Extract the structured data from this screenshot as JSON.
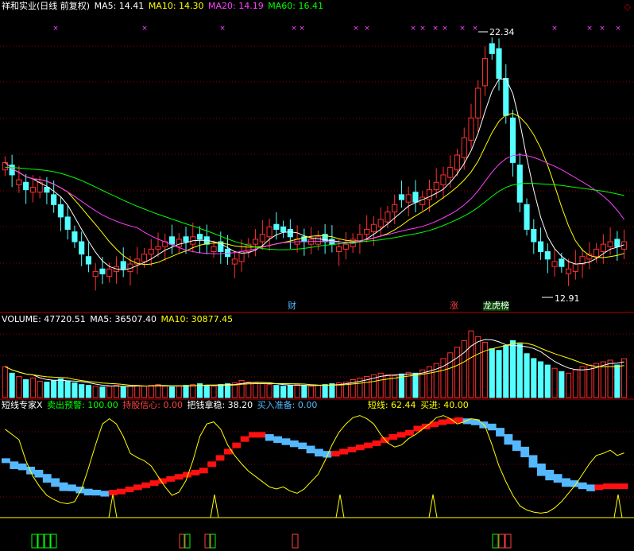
{
  "colors": {
    "up": "#ff3030",
    "down": "#54ffff",
    "ma5": "#ffffff",
    "ma10": "#ffff00",
    "ma20": "#ff40ff",
    "ma60": "#00ff00",
    "grid": "#8b0000",
    "axis": "#b00000",
    "sell": "#00ff00",
    "hold": "#ff4040",
    "grab": "#ffffff",
    "buy": "#54b8ff",
    "short": "#ffff00",
    "enter": "#ffff00"
  },
  "header": {
    "title": "祥和实业(日线 前复权)",
    "ma5": "MA5: 14.41",
    "ma10": "MA10: 14.30",
    "ma20": "MA20: 14.19",
    "ma60": "MA60: 16.41"
  },
  "corner_icon": "diamond-icon",
  "price_panel": {
    "high_label": "22.34",
    "low_label": "12.91",
    "events": [
      {
        "text": "财",
        "color": "#54b8ff"
      },
      {
        "text": "涨",
        "color": "#ff4040"
      },
      {
        "text": "龙虎榜",
        "color": "#ffffff"
      }
    ]
  },
  "volume_panel": {
    "volume": "VOLUME: 47720.51",
    "ma5": "MA5: 36507.40",
    "ma10": "MA10: 30877.45"
  },
  "indicator_panel": {
    "name": "短线专家X",
    "sell_warning": "卖出预警: 100.00",
    "hold_confidence": "持股信心: 0.00",
    "grab_money": "把钱拿稳: 38.20",
    "buy_ready": "买入准备: 0.00",
    "short_line": "短线: 62.44",
    "buy_in": "买进: 40.00"
  },
  "chart_data": [
    {
      "type": "candlestick",
      "title": "祥和实业(日线 前复权)",
      "ylim": [
        11.8,
        23.2
      ],
      "series": [
        {
          "name": "MA5",
          "value": 14.41
        },
        {
          "name": "MA10",
          "value": 14.3
        },
        {
          "name": "MA20",
          "value": 14.19
        },
        {
          "name": "MA60",
          "value": 16.41
        }
      ],
      "annotations": [
        {
          "text": "22.34",
          "kind": "high"
        },
        {
          "text": "12.91",
          "kind": "low"
        }
      ],
      "close": [
        17.6,
        17.1,
        16.9,
        16.5,
        16.6,
        16.8,
        16.4,
        15.9,
        15.4,
        14.9,
        14.4,
        13.9,
        13.5,
        13.2,
        13.1,
        13.3,
        13.4,
        13.3,
        13.5,
        13.7,
        13.9,
        14.1,
        14.2,
        14.4,
        14.3,
        14.5,
        14.4,
        14.6,
        14.5,
        14.3,
        14.2,
        14.0,
        13.8,
        13.7,
        14.0,
        14.3,
        14.5,
        14.7,
        15.0,
        14.9,
        14.8,
        14.6,
        14.5,
        14.4,
        14.5,
        14.6,
        14.4,
        14.3,
        14.2,
        14.3,
        14.5,
        14.7,
        14.9,
        15.1,
        15.3,
        15.6,
        15.9,
        16.1,
        16.3,
        16.0,
        16.2,
        16.5,
        16.8,
        17.1,
        17.4,
        17.9,
        18.6,
        19.4,
        20.6,
        21.8,
        22.0,
        21.0,
        19.5,
        17.6,
        16.0,
        14.9,
        14.4,
        14.0,
        13.7,
        13.6,
        13.4,
        13.3,
        13.5,
        13.8,
        13.9,
        14.1,
        14.3,
        14.4,
        14.2,
        14.4
      ],
      "open_offset": [
        0.3,
        -0.4,
        0.2,
        -0.3,
        0.2,
        0.4,
        -0.2,
        -0.4,
        -0.5,
        -0.5,
        -0.4,
        -0.5,
        -0.3,
        0.2,
        -0.2,
        0.3,
        0.2,
        -0.3,
        0.3,
        0.2,
        0.3,
        0.2,
        0.1,
        0.2,
        -0.3,
        0.3,
        -0.2,
        0.3,
        -0.2,
        -0.3,
        0.2,
        -0.4,
        -0.3,
        0.2,
        0.4,
        0.3,
        0.2,
        0.3,
        0.4,
        -0.2,
        -0.2,
        -0.3,
        0.2,
        -0.2,
        0.2,
        0.3,
        -0.3,
        -0.2,
        0.2,
        0.2,
        0.3,
        0.3,
        0.2,
        0.3,
        0.3,
        0.4,
        0.3,
        -0.2,
        0.3,
        -0.4,
        0.3,
        0.4,
        0.3,
        0.4,
        0.4,
        0.6,
        0.8,
        0.9,
        1.2,
        1.1,
        -0.4,
        -1.2,
        -1.5,
        -1.8,
        -1.5,
        -1.0,
        -0.5,
        -0.4,
        -0.3,
        0.2,
        -0.3,
        0.2,
        0.3,
        0.3,
        0.2,
        0.3,
        0.3,
        0.2,
        -0.3,
        0.3
      ]
    },
    {
      "type": "bar",
      "title": "VOLUME: 47720.51",
      "series": [
        {
          "name": "MA5",
          "value": 36507.4
        },
        {
          "name": "MA10",
          "value": 30877.45
        }
      ],
      "ylim": [
        0,
        90000
      ],
      "values": [
        38000,
        30000,
        26000,
        22000,
        24000,
        20000,
        19000,
        21000,
        23000,
        20000,
        18000,
        16000,
        15000,
        14000,
        13000,
        14000,
        15000,
        13000,
        14000,
        15000,
        14000,
        15000,
        16000,
        14000,
        13000,
        14000,
        15000,
        16000,
        17000,
        15000,
        14000,
        16000,
        17000,
        18000,
        21000,
        19000,
        18000,
        17000,
        16000,
        15000,
        14000,
        15000,
        16000,
        15000,
        14000,
        15000,
        16000,
        17000,
        18000,
        19000,
        22000,
        24000,
        26000,
        28000,
        30000,
        28000,
        27000,
        29000,
        31000,
        30000,
        34000,
        38000,
        42000,
        48000,
        55000,
        62000,
        70000,
        82000,
        75000,
        68000,
        60000,
        58000,
        64000,
        70000,
        66000,
        54000,
        48000,
        44000,
        40000,
        36000,
        32000,
        30000,
        34000,
        38000,
        40000,
        42000,
        44000,
        46000,
        40000,
        47720
      ]
    },
    {
      "type": "line",
      "title": "短线专家X",
      "ylim": [
        0,
        100
      ],
      "series": [
        {
          "name": "短线",
          "values": [
            85,
            80,
            75,
            55,
            40,
            30,
            22,
            18,
            15,
            14,
            16,
            28,
            48,
            70,
            90,
            95,
            90,
            78,
            62,
            58,
            55,
            50,
            40,
            30,
            22,
            25,
            36,
            55,
            78,
            90,
            92,
            85,
            70,
            60,
            52,
            45,
            40,
            35,
            30,
            28,
            30,
            26,
            24,
            28,
            35,
            42,
            55,
            70,
            82,
            90,
            96,
            98,
            95,
            90,
            80,
            72,
            68,
            70,
            76,
            80,
            85,
            90,
            96,
            98,
            95,
            90,
            92,
            95,
            94,
            88,
            70,
            50,
            35,
            22,
            12,
            8,
            6,
            5,
            6,
            10,
            16,
            24,
            32,
            42,
            52,
            60,
            62,
            65,
            60,
            62.44
          ]
        },
        {
          "name": "买进",
          "value": 40.0
        }
      ],
      "bands": [
        {
          "name": "卖出预警",
          "value": 100.0
        },
        {
          "name": "持股信心",
          "value": 0.0
        },
        {
          "name": "把钱拿稳",
          "value": 38.2
        },
        {
          "name": "买入准备",
          "value": 0.0
        }
      ],
      "ribbon": [
        55,
        52,
        50,
        47,
        44,
        40,
        36,
        32,
        30,
        28,
        26,
        25,
        24,
        25,
        26,
        28,
        30,
        32,
        34,
        36,
        38,
        40,
        42,
        44,
        46,
        52,
        58,
        64,
        70,
        76,
        80,
        80,
        78,
        76,
        74,
        72,
        70,
        67,
        64,
        62,
        62,
        64,
        66,
        68,
        70,
        72,
        75,
        78,
        80,
        82,
        86,
        88,
        90,
        92,
        93,
        94,
        93,
        92,
        90,
        88,
        84,
        78,
        72,
        66,
        58,
        50,
        44,
        40,
        36,
        34,
        32,
        30,
        30,
        31,
        31,
        31
      ]
    }
  ]
}
